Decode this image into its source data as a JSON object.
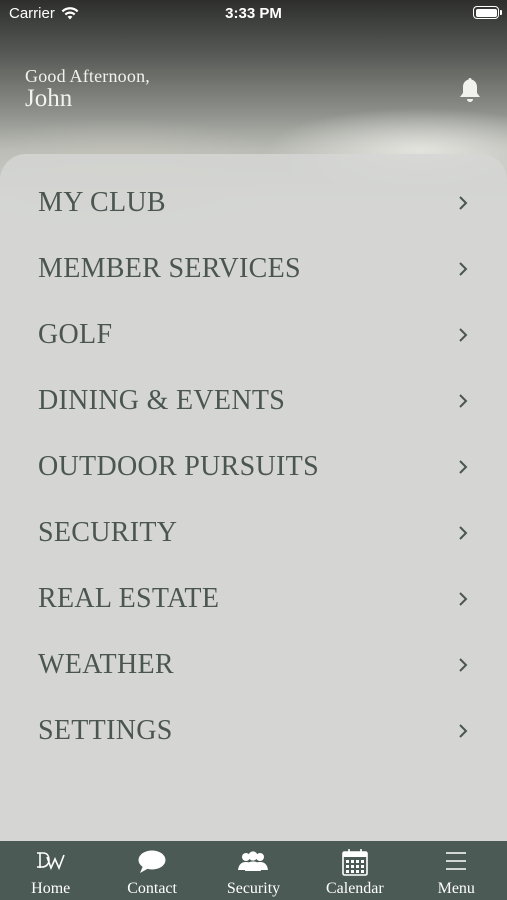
{
  "status_bar": {
    "carrier": "Carrier",
    "time": "3:33 PM"
  },
  "header": {
    "greeting": "Good Afternoon,",
    "name": "John"
  },
  "menu": {
    "items": [
      {
        "label": "MY CLUB"
      },
      {
        "label": "MEMBER SERVICES"
      },
      {
        "label": "GOLF"
      },
      {
        "label": "DINING & EVENTS"
      },
      {
        "label": "OUTDOOR PURSUITS"
      },
      {
        "label": "SECURITY"
      },
      {
        "label": "REAL ESTATE"
      },
      {
        "label": "WEATHER"
      },
      {
        "label": "SETTINGS"
      }
    ]
  },
  "tabbar": {
    "tabs": [
      {
        "label": "Home",
        "icon": "home-logo-icon"
      },
      {
        "label": "Contact",
        "icon": "chat-bubble-icon"
      },
      {
        "label": "Security",
        "icon": "people-icon"
      },
      {
        "label": "Calendar",
        "icon": "calendar-icon"
      },
      {
        "label": "Menu",
        "icon": "hamburger-icon"
      }
    ]
  },
  "colors": {
    "tabbar_bg": "#4b5a55",
    "menu_text": "#4b5651"
  }
}
